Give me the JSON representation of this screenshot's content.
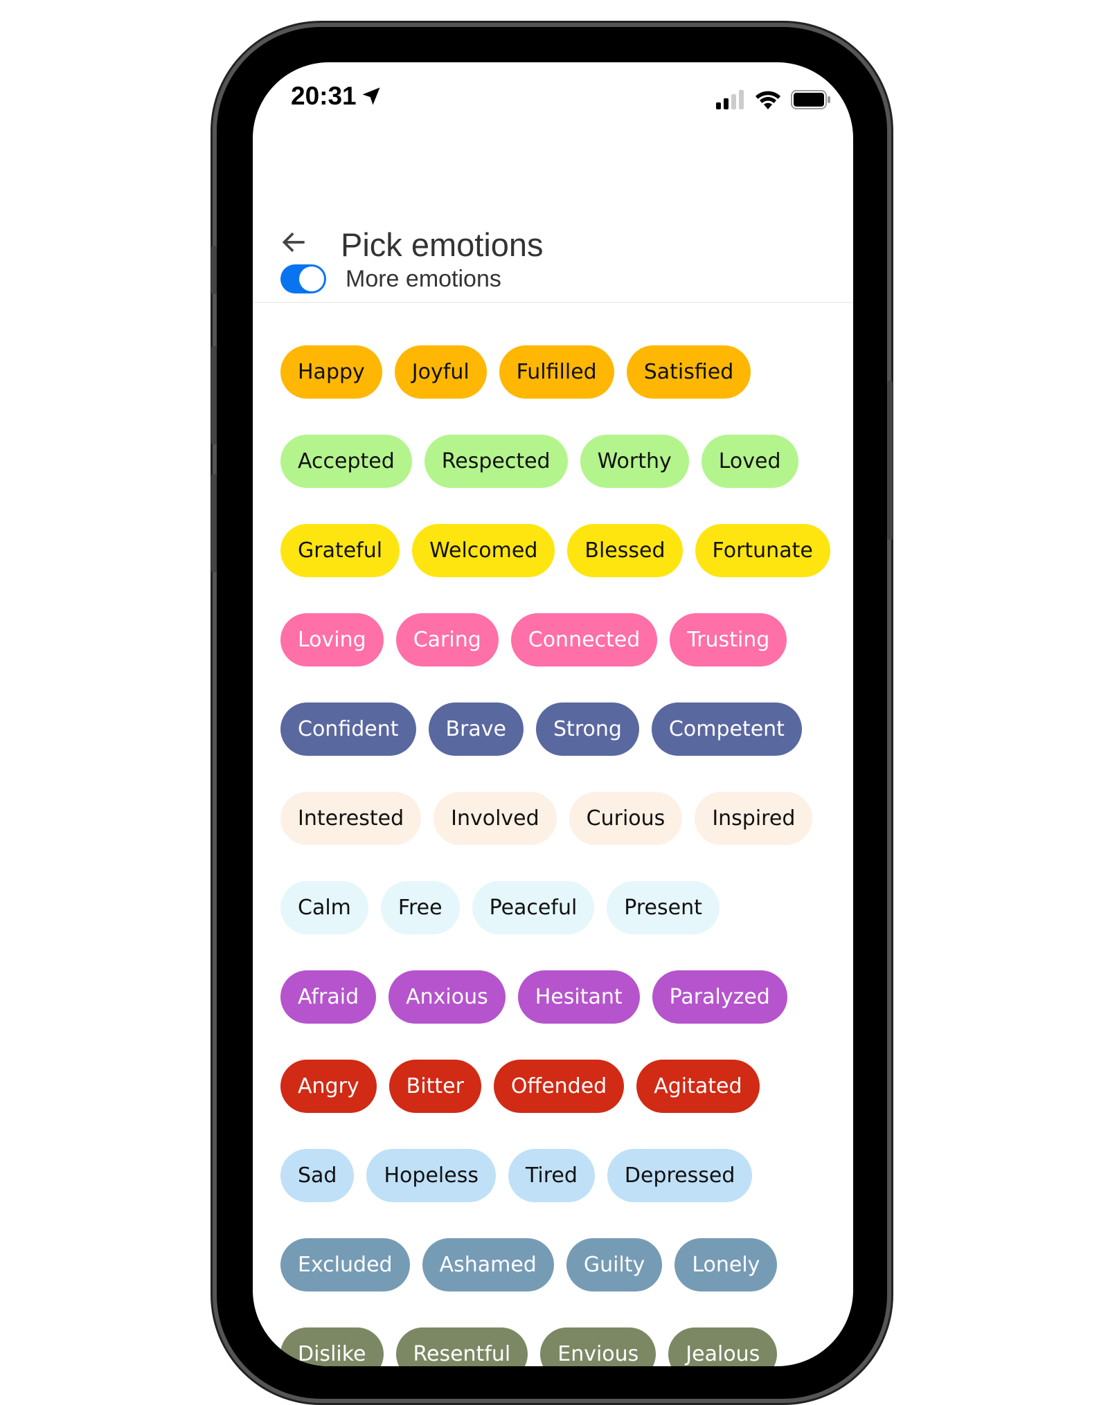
{
  "status_bar": {
    "time": "20:31",
    "icons": [
      "location-arrow-icon",
      "signal-icon",
      "wifi-icon",
      "battery-icon"
    ]
  },
  "header": {
    "title": "Pick emotions",
    "back_icon": "arrow-left-icon"
  },
  "toggle": {
    "label": "More emotions",
    "on": true,
    "color": "#0a74f0"
  },
  "groups": [
    {
      "bg": "#FFB703",
      "fg": "#111111",
      "items": [
        "Happy",
        "Joyful",
        "Fulfilled",
        "Satisfied"
      ]
    },
    {
      "bg": "#B3F58C",
      "fg": "#111111",
      "items": [
        "Accepted",
        "Respected",
        "Worthy",
        "Loved"
      ]
    },
    {
      "bg": "#FFE50F",
      "fg": "#111111",
      "items": [
        "Grateful",
        "Welcomed",
        "Blessed",
        "Fortunate"
      ]
    },
    {
      "bg": "#FF6FA8",
      "fg": "#ffffff",
      "items": [
        "Loving",
        "Caring",
        "Connected",
        "Trusting"
      ]
    },
    {
      "bg": "#5A68A0",
      "fg": "#ffffff",
      "items": [
        "Confident",
        "Brave",
        "Strong",
        "Competent"
      ]
    },
    {
      "bg": "#FDF0E4",
      "fg": "#111111",
      "items": [
        "Interested",
        "Involved",
        "Curious",
        "Inspired"
      ]
    },
    {
      "bg": "#E5F7FB",
      "fg": "#111111",
      "items": [
        "Calm",
        "Free",
        "Peaceful",
        "Present"
      ]
    },
    {
      "bg": "#B554CC",
      "fg": "#ffffff",
      "items": [
        "Afraid",
        "Anxious",
        "Hesitant",
        "Paralyzed"
      ]
    },
    {
      "bg": "#D12A15",
      "fg": "#ffffff",
      "items": [
        "Angry",
        "Bitter",
        "Offended",
        "Agitated"
      ]
    },
    {
      "bg": "#BFE0F7",
      "fg": "#111111",
      "items": [
        "Sad",
        "Hopeless",
        "Tired",
        "Depressed"
      ]
    },
    {
      "bg": "#769BB5",
      "fg": "#ffffff",
      "items": [
        "Excluded",
        "Ashamed",
        "Guilty",
        "Lonely"
      ]
    },
    {
      "bg": "#7B8863",
      "fg": "#ffffff",
      "items": [
        "Dislike",
        "Resentful",
        "Envious",
        "Jealous"
      ]
    }
  ]
}
